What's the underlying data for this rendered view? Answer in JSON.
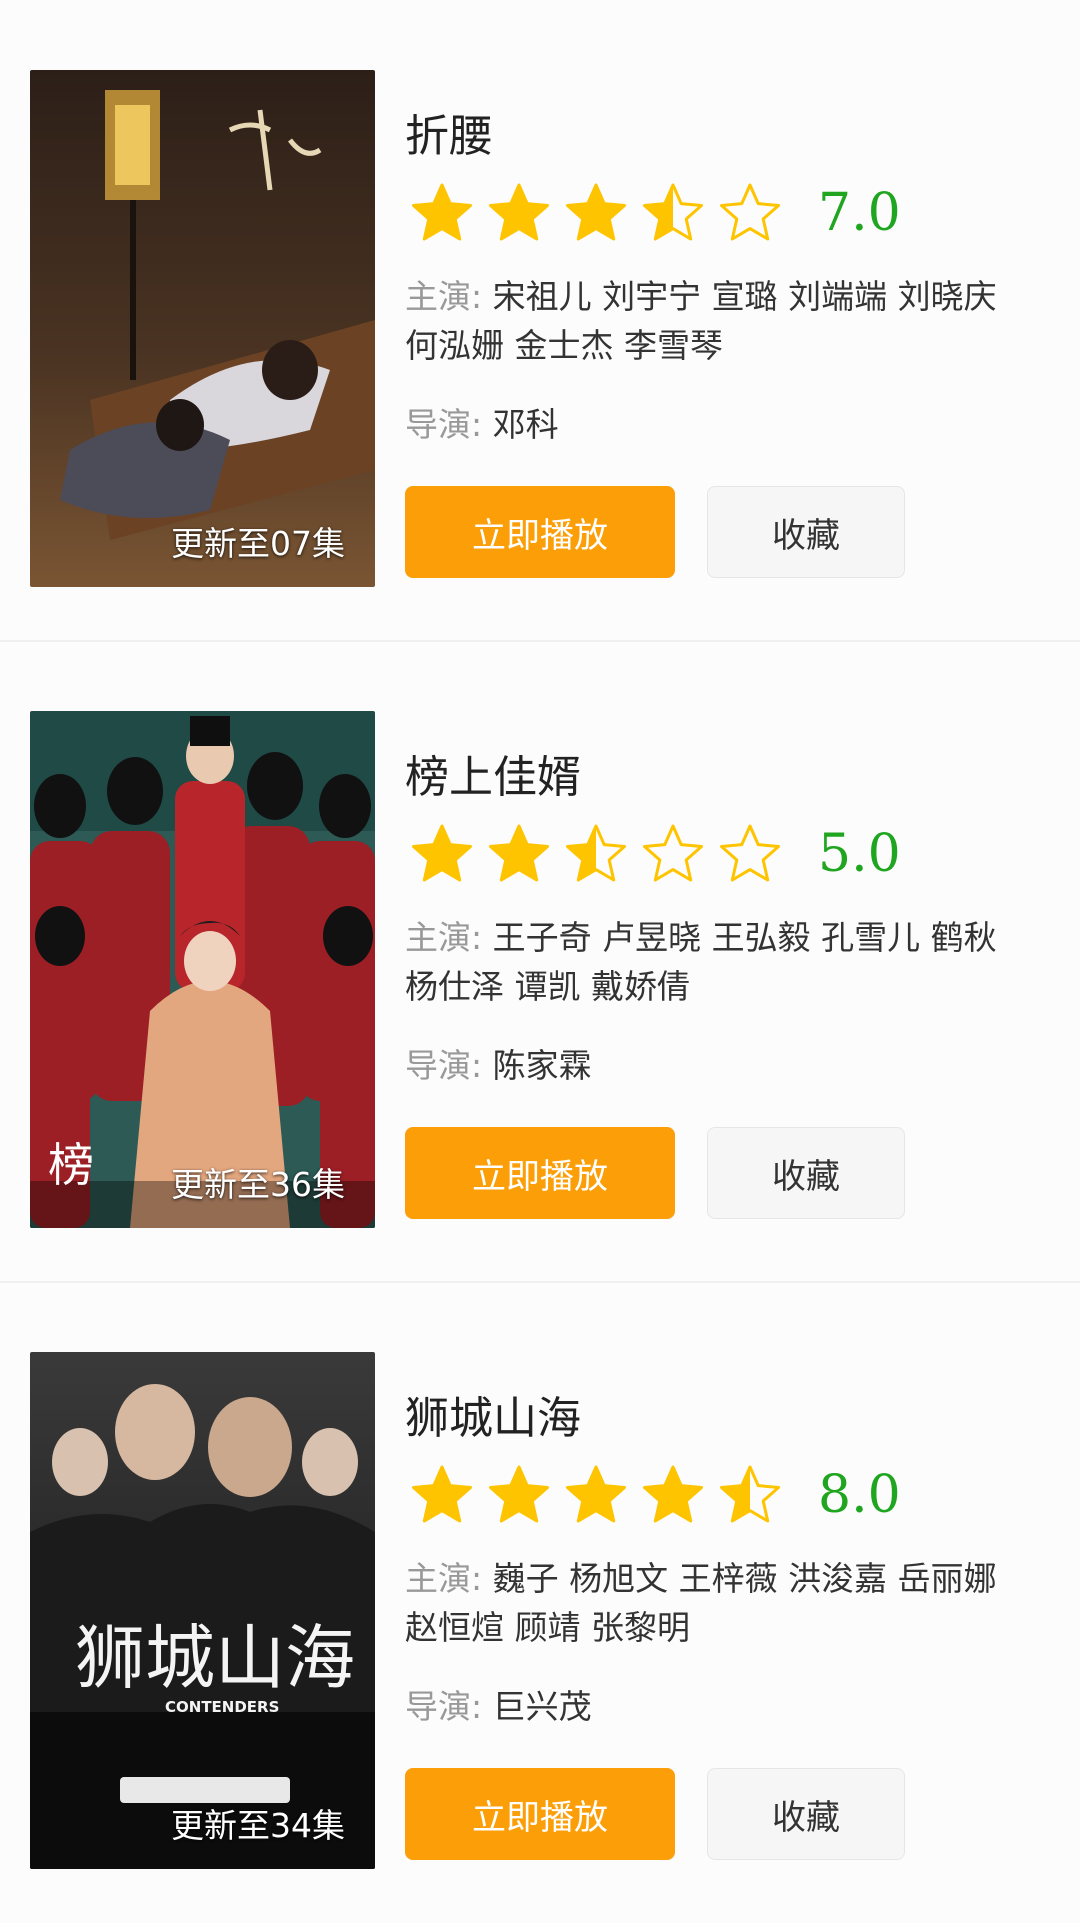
{
  "items": [
    {
      "title": "折腰",
      "rating": 3.5,
      "score": "7.0",
      "cast_label": "主演:",
      "cast": "宋祖儿 刘宇宁 宣璐 刘端端 刘晓庆 何泓姗 金士杰 李雪琴",
      "director_label": "导演:",
      "director": "邓科",
      "episode_badge": "更新至07集",
      "play_label": "立即播放",
      "fav_label": "收藏",
      "poster_colors": [
        "#3b2a1f",
        "#7a5533"
      ]
    },
    {
      "title": "榜上佳婿",
      "rating": 2.5,
      "score": "5.0",
      "cast_label": "主演:",
      "cast": "王子奇 卢昱晓 王弘毅 孔雪儿 鹤秋 杨仕泽 谭凯 戴娇倩",
      "director_label": "导演:",
      "director": "陈家霖",
      "episode_badge": "更新至36集",
      "play_label": "立即播放",
      "fav_label": "收藏",
      "poster_colors": [
        "#1f4a46",
        "#a8262a"
      ]
    },
    {
      "title": "狮城山海",
      "rating": 4.5,
      "score": "8.0",
      "cast_label": "主演:",
      "cast": "巍子 杨旭文 王梓薇 洪浚嘉 岳丽娜 赵恒煊 顾靖 张黎明",
      "director_label": "导演:",
      "director": "巨兴茂",
      "episode_badge": "更新至34集",
      "play_label": "立即播放",
      "fav_label": "收藏",
      "poster_colors": [
        "#1a1a1a",
        "#4b4b4b"
      ]
    }
  ],
  "star_colors": {
    "fill": "#ffc400",
    "outline": "#ffc400"
  }
}
